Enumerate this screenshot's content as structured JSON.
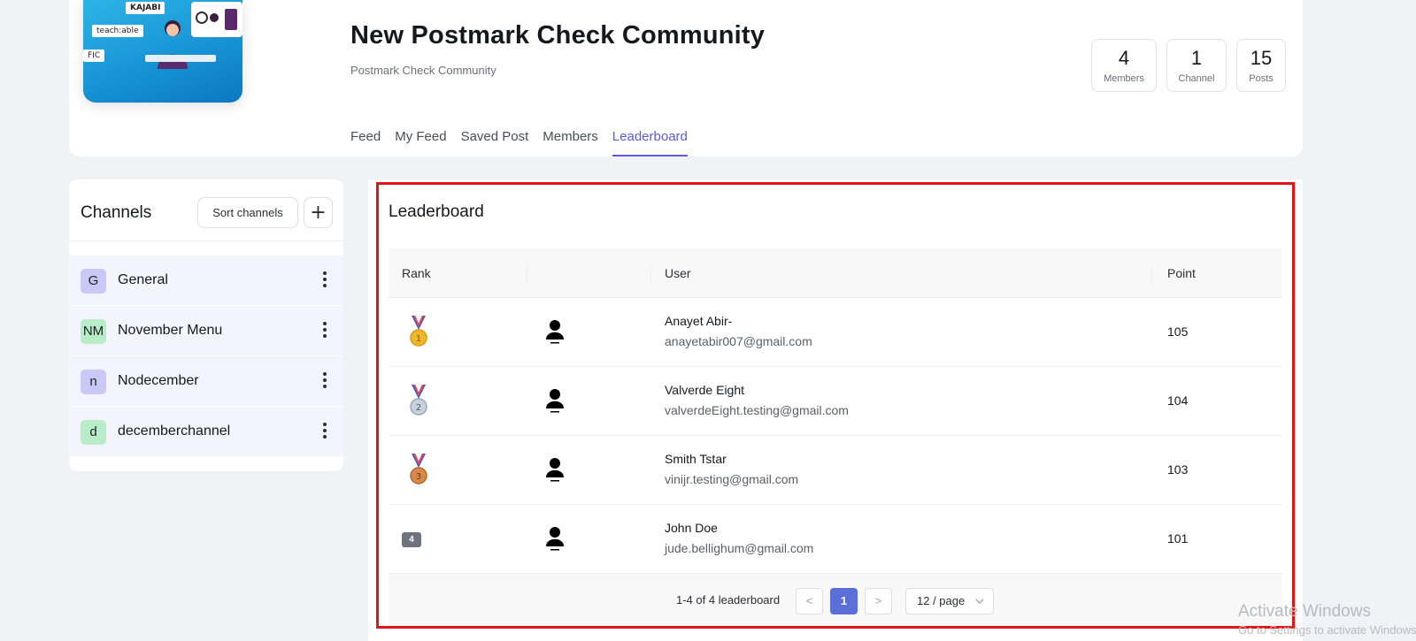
{
  "community": {
    "title": "New Postmark Check Community",
    "subtitle": "Postmark Check Community",
    "cover_labels": [
      "KAJABI",
      "teach:able",
      "FIC"
    ]
  },
  "stats": [
    {
      "value": "4",
      "label": "Members"
    },
    {
      "value": "1",
      "label": "Channel"
    },
    {
      "value": "15",
      "label": "Posts"
    }
  ],
  "tabs": [
    "Feed",
    "My Feed",
    "Saved Post",
    "Members",
    "Leaderboard"
  ],
  "active_tab": "Leaderboard",
  "channels": {
    "title": "Channels",
    "sort_label": "Sort channels",
    "add_label": "+",
    "items": [
      {
        "initial": "G",
        "name": "General",
        "color": "#c9c8f7"
      },
      {
        "initial": "NM",
        "name": "November Menu",
        "color": "#b9ecc9"
      },
      {
        "initial": "n",
        "name": "Nodecember",
        "color": "#c9c8f7"
      },
      {
        "initial": "d",
        "name": "decemberchannel",
        "color": "#b9ecc9"
      }
    ]
  },
  "leaderboard": {
    "title": "Leaderboard",
    "columns": {
      "rank": "Rank",
      "user": "User",
      "point": "Point"
    },
    "rows": [
      {
        "rank": "1",
        "medal": "gold-medal-icon",
        "name": "Anayet Abir-",
        "email": "anayetabir007@gmail.com",
        "points": "105"
      },
      {
        "rank": "2",
        "medal": "silver-medal-icon",
        "name": "Valverde Eight",
        "email": "valverdeEight.testing@gmail.com",
        "points": "104"
      },
      {
        "rank": "3",
        "medal": "bronze-medal-icon",
        "name": "Smith Tstar",
        "email": "vinijr.testing@gmail.com",
        "points": "103"
      },
      {
        "rank": "4",
        "medal": "",
        "name": "John Doe",
        "email": "jude.bellighum@gmail.com",
        "points": "101"
      }
    ],
    "pagination": {
      "info": "1-4 of 4 leaderboard",
      "prev": "<",
      "current": "1",
      "next": ">",
      "page_size": "12 / page"
    }
  },
  "watermark": {
    "title": "Activate Windows",
    "subtitle": "Go to Settings to activate Windows."
  },
  "colors": {
    "accent": "#5b5ce0",
    "highlight_frame": "#e41414",
    "gold": "#f1b72b",
    "silver": "#b9c4d0",
    "bronze": "#d98a4a"
  }
}
